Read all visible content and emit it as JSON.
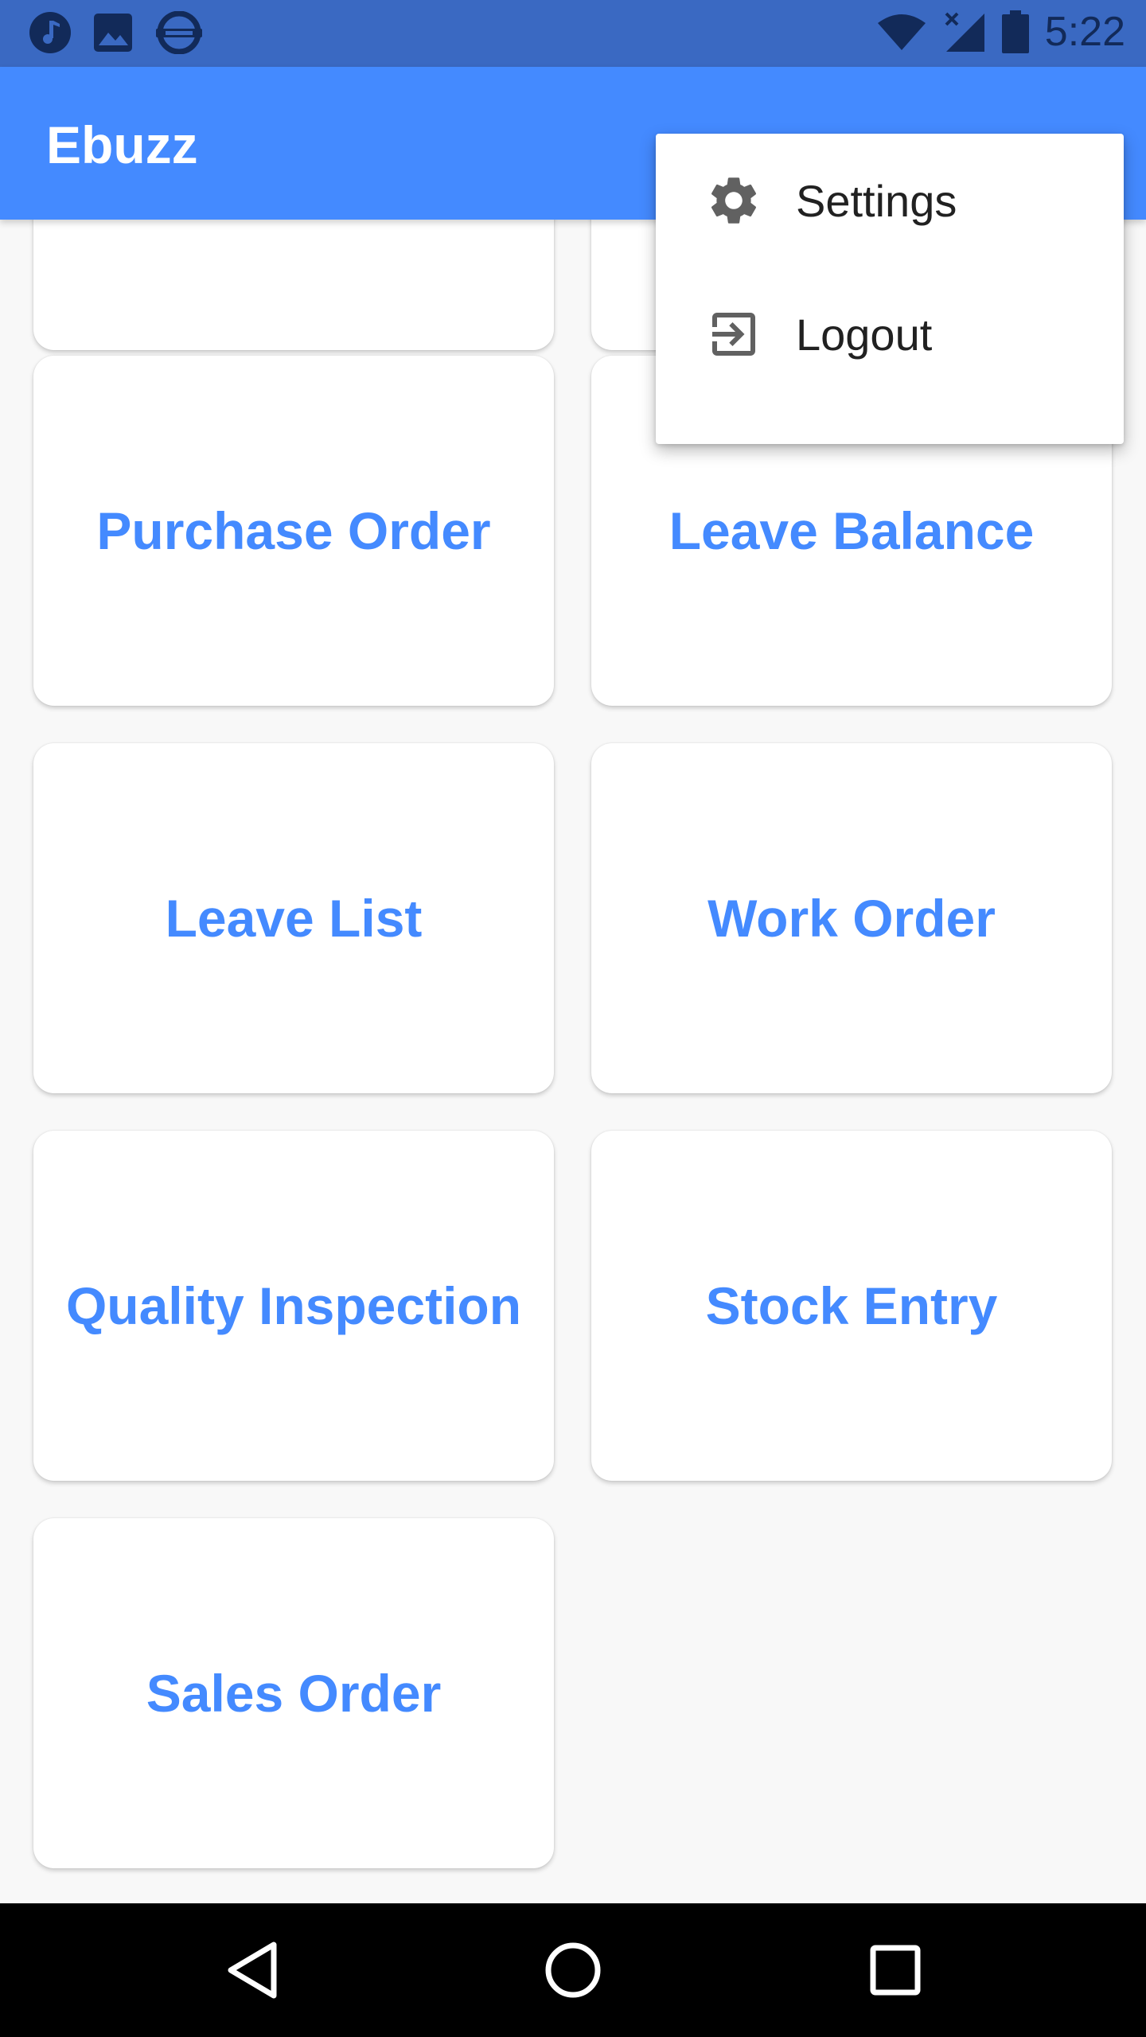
{
  "status_bar": {
    "left_icons": [
      "music-note-icon",
      "image-icon",
      "subway-icon"
    ],
    "right_icons": [
      "wifi-icon",
      "signal-no-data-icon",
      "battery-icon"
    ],
    "time": "5:22",
    "background_color": "#3a69c2"
  },
  "app_bar": {
    "title": "Ebuzz",
    "overflow_icon": "more-vert-icon",
    "background_color": "#448aff"
  },
  "menu": {
    "items": [
      {
        "label": "Settings",
        "icon": "gear-icon"
      },
      {
        "label": "Logout",
        "icon": "logout-icon"
      }
    ]
  },
  "tiles": [
    {
      "label": ""
    },
    {
      "label": ""
    },
    {
      "label": "Purchase Order"
    },
    {
      "label": "Leave Balance"
    },
    {
      "label": "Leave List"
    },
    {
      "label": "Work Order"
    },
    {
      "label": "Quality Inspection"
    },
    {
      "label": "Stock Entry"
    },
    {
      "label": "Sales Order"
    }
  ],
  "accent_color": "#448aff",
  "nav_bar": {
    "buttons": [
      "back-icon",
      "home-icon",
      "recents-icon"
    ]
  }
}
